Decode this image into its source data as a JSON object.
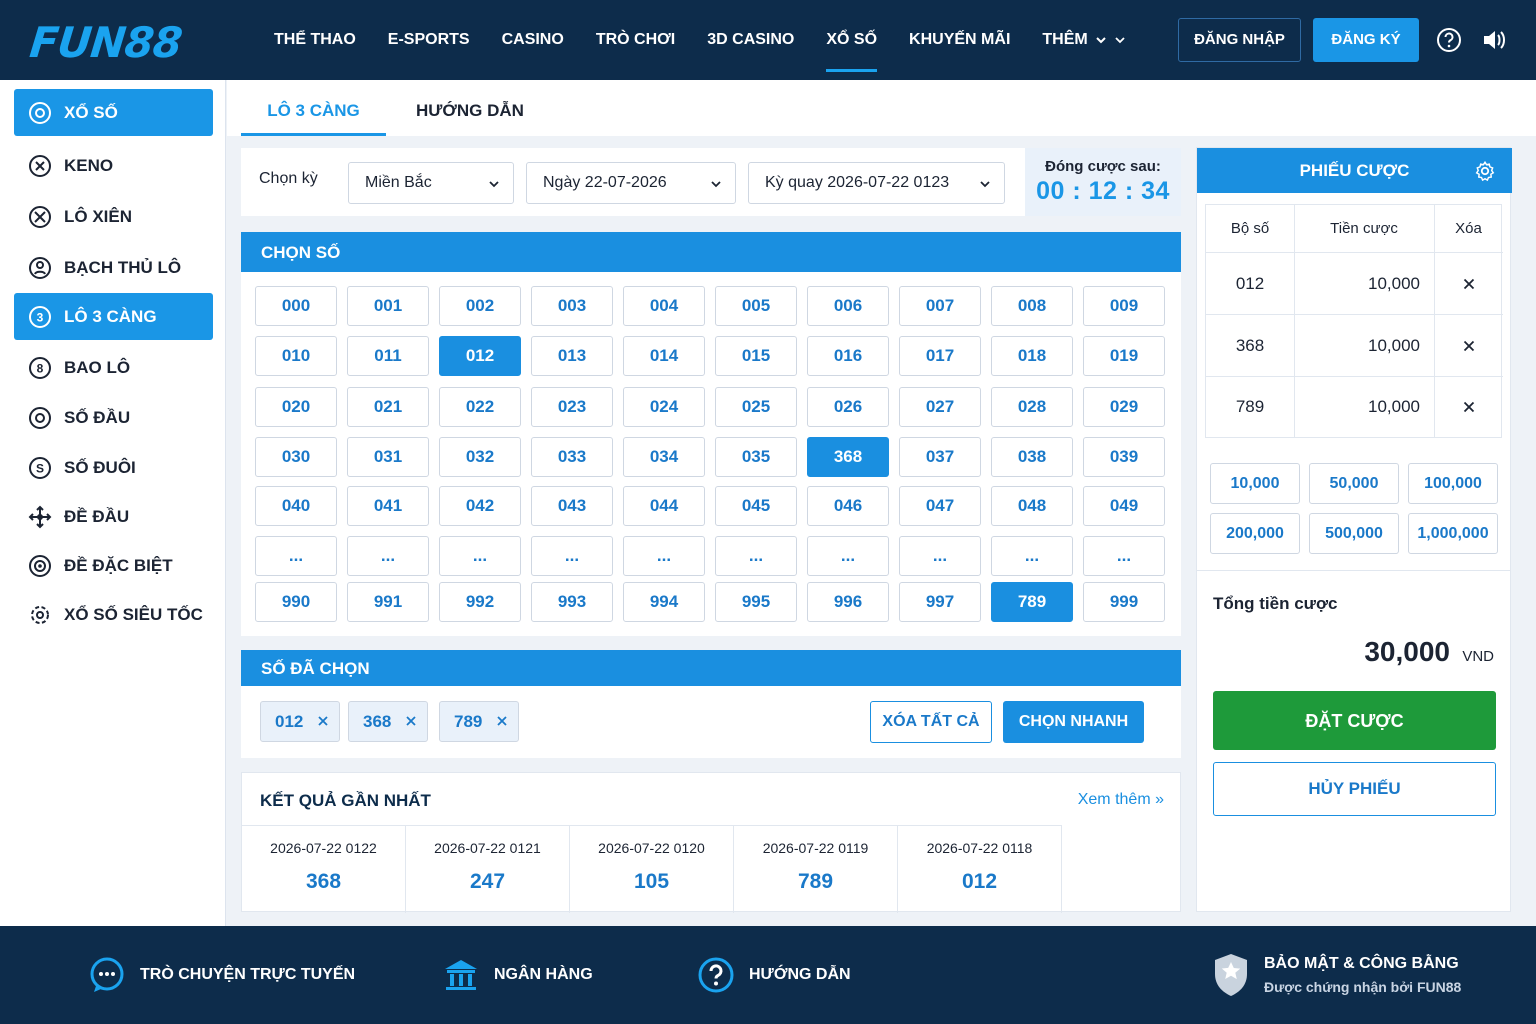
{
  "brand": {
    "logo": "FUN88",
    "accent": "#1a96e6",
    "dark": "#0d2c4b",
    "green": "#1e9a3a"
  },
  "nav": {
    "items": [
      "THỂ THAO",
      "E-SPORTS",
      "CASINO",
      "TRÒ CHƠI",
      "3D CASINO",
      "XỔ SỐ",
      "KHUYẾN MÃI"
    ],
    "active_index": 5,
    "more": "THÊM",
    "login": "ĐĂNG NHẬP",
    "register": "ĐĂNG KÝ"
  },
  "sidebar": {
    "items": [
      {
        "label": "XỔ SỐ",
        "icon": "lottery-ball-icon",
        "active": true
      },
      {
        "label": "KENO",
        "icon": "keno-icon",
        "active": false
      },
      {
        "label": "LÔ XIÊN",
        "icon": "cross-link-icon",
        "active": false
      },
      {
        "label": "BẠCH THỦ LÔ",
        "icon": "single-shot-icon",
        "active": false
      },
      {
        "label": "LÔ 3 CÀNG",
        "icon": "three-digit-icon",
        "active": true
      },
      {
        "label": "BAO LÔ",
        "icon": "eight-ball-icon",
        "active": false
      },
      {
        "label": "SỐ ĐẦU",
        "icon": "zero-ball-icon",
        "active": false
      },
      {
        "label": "SỐ ĐUÔI",
        "icon": "tail-ball-icon",
        "active": false
      },
      {
        "label": "ĐỀ ĐẦU",
        "icon": "move-arrows-icon",
        "active": false
      },
      {
        "label": "ĐỀ ĐẶC BIỆT",
        "icon": "special-ball-icon",
        "active": false
      },
      {
        "label": "XỔ SỐ SIÊU TỐC",
        "icon": "fast-lottery-icon",
        "active": false
      }
    ]
  },
  "tabs": [
    {
      "label": "LÔ 3 CÀNG",
      "active": true
    },
    {
      "label": "HƯỚNG DẪN",
      "active": false
    }
  ],
  "filter": {
    "label": "Chọn kỳ",
    "region": "Miền Bắc",
    "date": "Ngày 22-07-2026",
    "draw": "Kỳ quay 2026-07-22 0123"
  },
  "countdown": {
    "label": "Đóng cược sau:",
    "time": "00 : 12 : 34"
  },
  "number_grid": {
    "title": "CHỌN SỐ",
    "rows": [
      [
        "000",
        "001",
        "002",
        "003",
        "004",
        "005",
        "006",
        "007",
        "008",
        "009"
      ],
      [
        "010",
        "011",
        "012",
        "013",
        "014",
        "015",
        "016",
        "017",
        "018",
        "019"
      ],
      [
        "020",
        "021",
        "022",
        "023",
        "024",
        "025",
        "026",
        "027",
        "028",
        "029"
      ],
      [
        "030",
        "031",
        "032",
        "033",
        "034",
        "035",
        "368",
        "037",
        "038",
        "039"
      ],
      [
        "040",
        "041",
        "042",
        "043",
        "044",
        "045",
        "046",
        "047",
        "048",
        "049"
      ],
      [
        "...",
        "...",
        "...",
        "...",
        "...",
        "...",
        "...",
        "...",
        "...",
        "..."
      ],
      [
        "990",
        "991",
        "992",
        "993",
        "994",
        "995",
        "996",
        "997",
        "789",
        "999"
      ]
    ],
    "selected": [
      "012",
      "368",
      "789"
    ]
  },
  "chosen": {
    "title": "SỐ ĐÃ CHỌN",
    "chips": [
      "012",
      "368",
      "789"
    ],
    "clear_all": "XÓA TẤT CẢ",
    "quick_pick": "CHỌN NHANH"
  },
  "results": {
    "title": "KẾT QUẢ GẦN NHẤT",
    "more": "Xem thêm »",
    "items": [
      {
        "draw": "2026-07-22 0122",
        "number": "368"
      },
      {
        "draw": "2026-07-22 0121",
        "number": "247"
      },
      {
        "draw": "2026-07-22 0120",
        "number": "105"
      },
      {
        "draw": "2026-07-22 0119",
        "number": "789"
      },
      {
        "draw": "2026-07-22 0118",
        "number": "012"
      }
    ]
  },
  "slip": {
    "title": "PHIẾU CƯỢC",
    "columns": [
      "Bộ số",
      "Tiền cược",
      "Xóa"
    ],
    "rows": [
      {
        "number": "012",
        "amount": "10,000"
      },
      {
        "number": "368",
        "amount": "10,000"
      },
      {
        "number": "789",
        "amount": "10,000"
      }
    ],
    "amounts": [
      "10,000",
      "50,000",
      "100,000",
      "200,000",
      "500,000",
      "1,000,000"
    ],
    "total_label": "Tổng tiền cược",
    "total_value": "30,000",
    "currency": "VND",
    "place_bet": "ĐẶT CƯỢC",
    "cancel": "HỦY PHIẾU"
  },
  "footer": {
    "chat": "TRÒ CHUYỆN TRỰC TUYẾN",
    "bank": "NGÂN HÀNG",
    "guide": "HƯỚNG DẪN",
    "security_title": "BẢO MẬT & CÔNG BẰNG",
    "security_sub": "Được chứng nhận bởi FUN88"
  }
}
